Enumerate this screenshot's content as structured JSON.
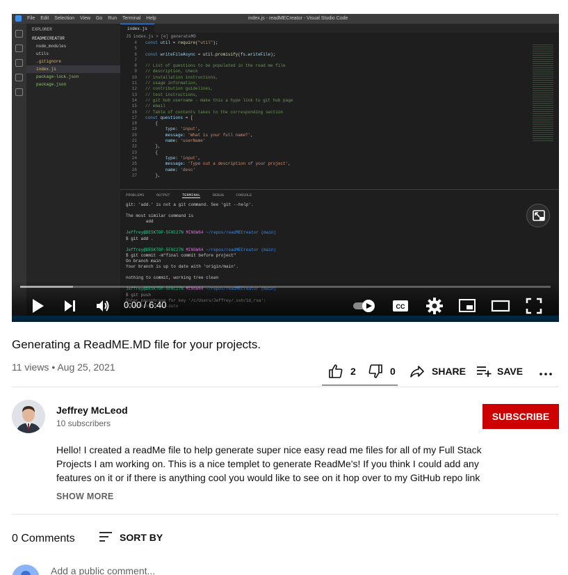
{
  "player": {
    "app_menu": "File Edit Selection View Go Run Terminal Help",
    "window_title": "index.js - readMECreator - Visual Studio Code",
    "explorer_header": "EXPLORER",
    "project": "READMECREATOR",
    "files": [
      {
        "name": "node_modules",
        "style": ""
      },
      {
        "name": "utils",
        "style": ""
      },
      {
        "name": ".gitignore",
        "style": "y"
      },
      {
        "name": "index.js",
        "style": "y sel"
      },
      {
        "name": "package-lock.json",
        "style": "g"
      },
      {
        "name": "package.json",
        "style": "g"
      }
    ],
    "editor_tab": "index.js",
    "breadcrumb": "JS index.js > [e] generateMD",
    "code_lines": [
      {
        "n": "4",
        "html": "<span class='c-kw'>const</span> <span class='c-var'>util</span> = <span class='c-fn'>require</span>(<span class='c-str'>\"util\"</span>);"
      },
      {
        "n": "5",
        "html": ""
      },
      {
        "n": "6",
        "html": "<span class='c-kw'>const</span> <span class='c-var'>writeFileAsync</span> = util.<span class='c-fn'>promisify</span>(fs.<span class='c-var'>writeFile</span>);"
      },
      {
        "n": "7",
        "html": ""
      },
      {
        "n": "8",
        "html": "<span class='c-com'>// List of questions to be populated in the read me file</span>"
      },
      {
        "n": "9",
        "html": "<span class='c-com'>// description, check</span>"
      },
      {
        "n": "10",
        "html": "<span class='c-com'>// installation instructions,</span>"
      },
      {
        "n": "11",
        "html": "<span class='c-com'>// usage information,</span>"
      },
      {
        "n": "12",
        "html": "<span class='c-com'>// contribution guidelines,</span>"
      },
      {
        "n": "13",
        "html": "<span class='c-com'>// test instructions,</span>"
      },
      {
        "n": "14",
        "html": "<span class='c-com'>// git hub username - make this a hype link to git hub page</span>"
      },
      {
        "n": "15",
        "html": "<span class='c-com'>// email</span>"
      },
      {
        "n": "16",
        "html": "<span class='c-com'>// Table of contents takes to the corresponding section</span>"
      },
      {
        "n": "17",
        "html": "<span class='c-kw'>const</span> <span class='c-var'>questions</span> = ["
      },
      {
        "n": "18",
        "html": "    {"
      },
      {
        "n": "19",
        "html": "        <span class='c-var'>type</span>: <span class='c-str'>'input'</span>,"
      },
      {
        "n": "20",
        "html": "        <span class='c-var'>message</span>: <span class='c-str'>'What is your full name?'</span>,"
      },
      {
        "n": "21",
        "html": "        <span class='c-var'>name</span>: <span class='c-str'>'userName'</span>"
      },
      {
        "n": "22",
        "html": "    },"
      },
      {
        "n": "23",
        "html": "    {"
      },
      {
        "n": "24",
        "html": "        <span class='c-var'>type</span>: <span class='c-str'>'input'</span>,"
      },
      {
        "n": "25",
        "html": "        <span class='c-var'>message</span>: <span class='c-str'>'Type out a description of your project'</span>,"
      },
      {
        "n": "26",
        "html": "        <span class='c-var'>name</span>: <span class='c-str'>'desc'</span>"
      },
      {
        "n": "27",
        "html": "    },"
      }
    ],
    "panel_tabs": [
      "PROBLEMS",
      "OUTPUT",
      "TERMINAL",
      "DEBUG CONSOLE"
    ],
    "terminal_html": "git: 'add.' is not a git command. See 'git --help'.\n\nThe most similar command is\n        add\n\n<span class='t-g'>Jeffrey@DESKTOP-5F0C27N</span> <span class='t-m'>MINGW64</span> <span class='t-b'>~/repos/readMECreator</span> <span class='t-b'>(main)</span>\n$ git add .\n\n<span class='t-g'>Jeffrey@DESKTOP-5F0C27N</span> <span class='t-m'>MINGW64</span> <span class='t-b'>~/repos/readMECreator</span> <span class='t-b'>(main)</span>\n$ git commit -m\"final commit before project\"\nOn branch main\nYour branch is up to date with 'origin/main'.\n\nnothing to commit, working tree clean\n\n<span class='t-g'>Jeffrey@DESKTOP-5F0C27N</span> <span class='t-m'>MINGW64</span> <span class='t-b'>~/repos/readMECreator</span> <span class='t-b'>(main)</span>\n$ git push\nEnter passphrase for key '/c/Users/Jeffrey/.ssh/id_rsa':\nEverything up-to-date",
    "time": "0:00 / 6:40",
    "progress_played": 0.0,
    "progress_buffered": 0.1
  },
  "video": {
    "title": "Generating a ReadME.MD file for your projects.",
    "meta": "11 views • Aug 25, 2021",
    "likes": "2",
    "dislikes": "0",
    "share": "SHARE",
    "save": "SAVE"
  },
  "channel": {
    "name": "Jeffrey McLeod",
    "subscribers": "10 subscribers",
    "subscribe": "SUBSCRIBE"
  },
  "description": {
    "text": "Hello! I created a readMe file to help generate super nice easy read me files for all of my Full Stack Projects I am working on. This is a nice templet to generate ReadMe's! If you think I could add any features on it or if there is anything cool you would like to see on it hop over to my GitHub repo link",
    "show_more": "SHOW MORE"
  },
  "comments": {
    "count": "0 Comments",
    "sort_by": "SORT BY",
    "placeholder": "Add a public comment..."
  },
  "colors": {
    "subscribe_bg": "#cc0000",
    "progress_played": "#ff0000"
  }
}
